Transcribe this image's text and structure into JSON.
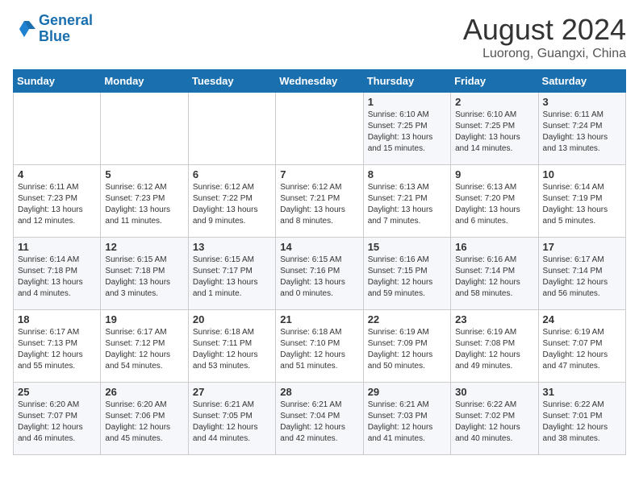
{
  "header": {
    "logo_line1": "General",
    "logo_line2": "Blue",
    "month": "August 2024",
    "location": "Luorong, Guangxi, China"
  },
  "weekdays": [
    "Sunday",
    "Monday",
    "Tuesday",
    "Wednesday",
    "Thursday",
    "Friday",
    "Saturday"
  ],
  "weeks": [
    [
      {
        "day": "",
        "info": ""
      },
      {
        "day": "",
        "info": ""
      },
      {
        "day": "",
        "info": ""
      },
      {
        "day": "",
        "info": ""
      },
      {
        "day": "1",
        "info": "Sunrise: 6:10 AM\nSunset: 7:25 PM\nDaylight: 13 hours\nand 15 minutes."
      },
      {
        "day": "2",
        "info": "Sunrise: 6:10 AM\nSunset: 7:25 PM\nDaylight: 13 hours\nand 14 minutes."
      },
      {
        "day": "3",
        "info": "Sunrise: 6:11 AM\nSunset: 7:24 PM\nDaylight: 13 hours\nand 13 minutes."
      }
    ],
    [
      {
        "day": "4",
        "info": "Sunrise: 6:11 AM\nSunset: 7:23 PM\nDaylight: 13 hours\nand 12 minutes."
      },
      {
        "day": "5",
        "info": "Sunrise: 6:12 AM\nSunset: 7:23 PM\nDaylight: 13 hours\nand 11 minutes."
      },
      {
        "day": "6",
        "info": "Sunrise: 6:12 AM\nSunset: 7:22 PM\nDaylight: 13 hours\nand 9 minutes."
      },
      {
        "day": "7",
        "info": "Sunrise: 6:12 AM\nSunset: 7:21 PM\nDaylight: 13 hours\nand 8 minutes."
      },
      {
        "day": "8",
        "info": "Sunrise: 6:13 AM\nSunset: 7:21 PM\nDaylight: 13 hours\nand 7 minutes."
      },
      {
        "day": "9",
        "info": "Sunrise: 6:13 AM\nSunset: 7:20 PM\nDaylight: 13 hours\nand 6 minutes."
      },
      {
        "day": "10",
        "info": "Sunrise: 6:14 AM\nSunset: 7:19 PM\nDaylight: 13 hours\nand 5 minutes."
      }
    ],
    [
      {
        "day": "11",
        "info": "Sunrise: 6:14 AM\nSunset: 7:18 PM\nDaylight: 13 hours\nand 4 minutes."
      },
      {
        "day": "12",
        "info": "Sunrise: 6:15 AM\nSunset: 7:18 PM\nDaylight: 13 hours\nand 3 minutes."
      },
      {
        "day": "13",
        "info": "Sunrise: 6:15 AM\nSunset: 7:17 PM\nDaylight: 13 hours\nand 1 minute."
      },
      {
        "day": "14",
        "info": "Sunrise: 6:15 AM\nSunset: 7:16 PM\nDaylight: 13 hours\nand 0 minutes."
      },
      {
        "day": "15",
        "info": "Sunrise: 6:16 AM\nSunset: 7:15 PM\nDaylight: 12 hours\nand 59 minutes."
      },
      {
        "day": "16",
        "info": "Sunrise: 6:16 AM\nSunset: 7:14 PM\nDaylight: 12 hours\nand 58 minutes."
      },
      {
        "day": "17",
        "info": "Sunrise: 6:17 AM\nSunset: 7:14 PM\nDaylight: 12 hours\nand 56 minutes."
      }
    ],
    [
      {
        "day": "18",
        "info": "Sunrise: 6:17 AM\nSunset: 7:13 PM\nDaylight: 12 hours\nand 55 minutes."
      },
      {
        "day": "19",
        "info": "Sunrise: 6:17 AM\nSunset: 7:12 PM\nDaylight: 12 hours\nand 54 minutes."
      },
      {
        "day": "20",
        "info": "Sunrise: 6:18 AM\nSunset: 7:11 PM\nDaylight: 12 hours\nand 53 minutes."
      },
      {
        "day": "21",
        "info": "Sunrise: 6:18 AM\nSunset: 7:10 PM\nDaylight: 12 hours\nand 51 minutes."
      },
      {
        "day": "22",
        "info": "Sunrise: 6:19 AM\nSunset: 7:09 PM\nDaylight: 12 hours\nand 50 minutes."
      },
      {
        "day": "23",
        "info": "Sunrise: 6:19 AM\nSunset: 7:08 PM\nDaylight: 12 hours\nand 49 minutes."
      },
      {
        "day": "24",
        "info": "Sunrise: 6:19 AM\nSunset: 7:07 PM\nDaylight: 12 hours\nand 47 minutes."
      }
    ],
    [
      {
        "day": "25",
        "info": "Sunrise: 6:20 AM\nSunset: 7:07 PM\nDaylight: 12 hours\nand 46 minutes."
      },
      {
        "day": "26",
        "info": "Sunrise: 6:20 AM\nSunset: 7:06 PM\nDaylight: 12 hours\nand 45 minutes."
      },
      {
        "day": "27",
        "info": "Sunrise: 6:21 AM\nSunset: 7:05 PM\nDaylight: 12 hours\nand 44 minutes."
      },
      {
        "day": "28",
        "info": "Sunrise: 6:21 AM\nSunset: 7:04 PM\nDaylight: 12 hours\nand 42 minutes."
      },
      {
        "day": "29",
        "info": "Sunrise: 6:21 AM\nSunset: 7:03 PM\nDaylight: 12 hours\nand 41 minutes."
      },
      {
        "day": "30",
        "info": "Sunrise: 6:22 AM\nSunset: 7:02 PM\nDaylight: 12 hours\nand 40 minutes."
      },
      {
        "day": "31",
        "info": "Sunrise: 6:22 AM\nSunset: 7:01 PM\nDaylight: 12 hours\nand 38 minutes."
      }
    ]
  ]
}
